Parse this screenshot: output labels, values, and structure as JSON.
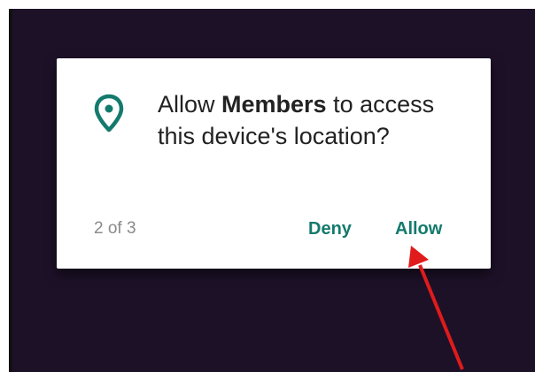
{
  "dialog": {
    "message_prefix": "Allow ",
    "app_name": "Members",
    "message_suffix": " to access this device's location?",
    "counter": "2 of 3",
    "deny_label": "Deny",
    "allow_label": "Allow",
    "icon": "location-pin-icon"
  },
  "colors": {
    "background": "#1d1128",
    "dialog": "#ffffff",
    "accent": "#147a6d",
    "arrow": "#e01b1b"
  }
}
